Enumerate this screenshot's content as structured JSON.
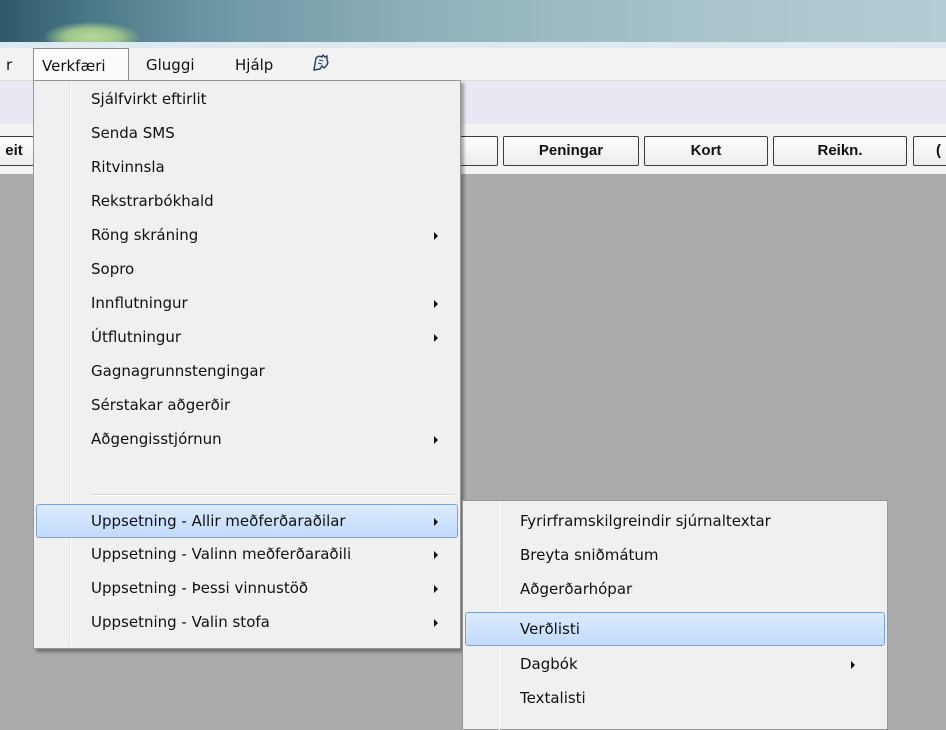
{
  "menubar": {
    "items": [
      {
        "label": "r"
      },
      {
        "label": "Verkfæri"
      },
      {
        "label": "Gluggi"
      },
      {
        "label": "Hjálp"
      }
    ]
  },
  "toolbar": {
    "buttons": [
      {
        "label": "eit"
      },
      {
        "label": ""
      },
      {
        "label": "Peningar"
      },
      {
        "label": "Kort"
      },
      {
        "label": "Reikn."
      },
      {
        "label": "("
      }
    ]
  },
  "dropdown": {
    "items": [
      {
        "label": "Sjálfvirkt eftirlit",
        "submenu": false
      },
      {
        "label": "Senda SMS",
        "submenu": false
      },
      {
        "label": "Ritvinnsla",
        "submenu": false
      },
      {
        "label": "Rekstrarbókhald",
        "submenu": false
      },
      {
        "label": "Röng skráning",
        "submenu": true
      },
      {
        "label": "Sopro",
        "submenu": false
      },
      {
        "label": "Innflutningur",
        "submenu": true
      },
      {
        "label": "Útflutningur",
        "submenu": true
      },
      {
        "label": "Gagnagrunnstengingar",
        "submenu": false
      },
      {
        "label": "Sérstakar aðgerðir",
        "submenu": false
      },
      {
        "label": "Aðgengisstjórnun",
        "submenu": true
      },
      {
        "label": "Uppsetning - Allir meðferðaraðilar",
        "submenu": true,
        "highlighted": true
      },
      {
        "label": "Uppsetning - Valinn meðferðaraðili",
        "submenu": true
      },
      {
        "label": "Uppsetning - Þessi vinnustöð",
        "submenu": true
      },
      {
        "label": "Uppsetning - Valin stofa",
        "submenu": true
      }
    ]
  },
  "submenu": {
    "items": [
      {
        "label": "Fyrirframskilgreindir sjúrnaltextar",
        "submenu": false
      },
      {
        "label": "Breyta sniðmátum",
        "submenu": false
      },
      {
        "label": "Aðgerðarhópar",
        "submenu": false
      },
      {
        "label": "Verðlisti",
        "submenu": false,
        "highlighted": true
      },
      {
        "label": "Dagbók",
        "submenu": true
      },
      {
        "label": "Textalisti",
        "submenu": false
      }
    ]
  },
  "colors": {
    "highlight": "#c1dbfc",
    "highlight_border": "#7da2ce",
    "workspace": "#ababab"
  }
}
